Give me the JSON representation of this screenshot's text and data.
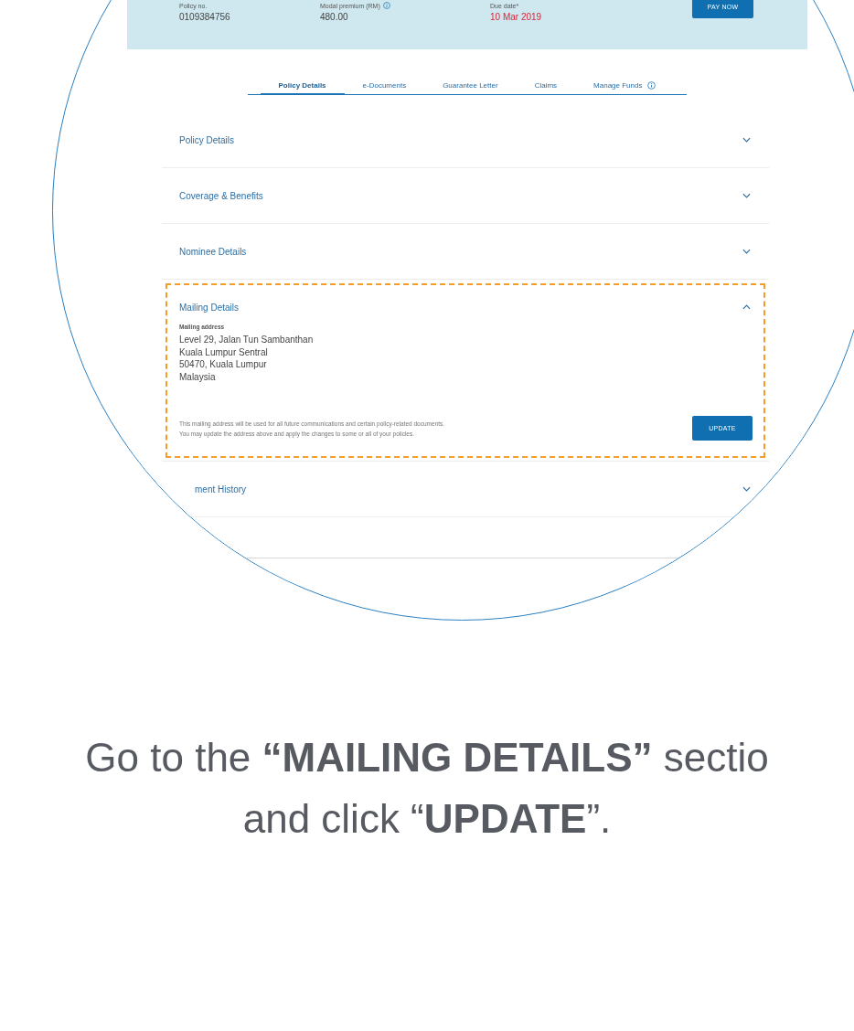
{
  "policy_summary": {
    "fields": [
      {
        "label": "Policy no.",
        "value": "0109384756",
        "info": false,
        "alert": false
      },
      {
        "label": "Modal premium (RM)",
        "value": "480.00",
        "info": true,
        "alert": false
      },
      {
        "label": "Due date*",
        "value": "10 Mar 2019",
        "info": false,
        "alert": true
      }
    ],
    "pay_button": "PAY NOW"
  },
  "tabs": [
    {
      "label": "Policy Details",
      "selected": true,
      "info": false
    },
    {
      "label": "e-Documents",
      "selected": false,
      "info": false
    },
    {
      "label": "Guarantee Letter",
      "selected": false,
      "info": false
    },
    {
      "label": "Claims",
      "selected": false,
      "info": false
    },
    {
      "label": "Manage Funds",
      "selected": false,
      "info": true
    }
  ],
  "sections": [
    {
      "title": "Policy Details",
      "expanded": false,
      "highlighted": false,
      "partial": false
    },
    {
      "title": "Coverage & Benefits",
      "expanded": false,
      "highlighted": false,
      "partial": false
    },
    {
      "title": "Nominee Details",
      "expanded": false,
      "highlighted": false,
      "partial": false
    },
    {
      "title": "Mailing Details",
      "expanded": true,
      "highlighted": true,
      "partial": false,
      "address_label": "Mailing address",
      "address_lines": [
        "Level 29, Jalan Tun Sambanthan",
        "Kuala Lumpur Sentral",
        "50470, Kuala Lumpur",
        "Malaysia"
      ],
      "note_lines": [
        "This mailing address will be used for all future communications and certain policy-related documents.",
        "You may update the address above and apply the changes to some or all of your policies."
      ],
      "update_button": "UPDATE"
    },
    {
      "title": "ment History",
      "expanded": false,
      "highlighted": false,
      "partial": true
    }
  ],
  "caption": {
    "lines": [
      "Go to the **“MAILING DETAILS”** sectio",
      "and click “**UPDATE**”."
    ]
  }
}
